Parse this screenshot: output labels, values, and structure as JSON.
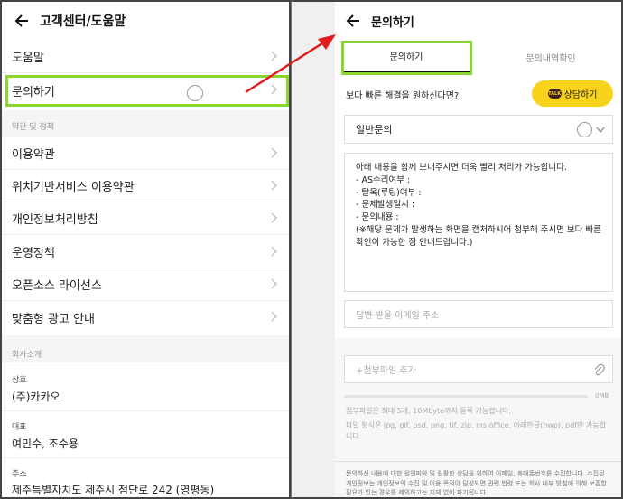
{
  "left": {
    "title": "고객센터/도움말",
    "menu": [
      {
        "label": "도움말"
      },
      {
        "label": "문의하기"
      }
    ],
    "terms_section": "약관 및 정책",
    "terms": [
      {
        "label": "이용약관"
      },
      {
        "label": "위치기반서비스 이용약관"
      },
      {
        "label": "개인정보처리방침"
      },
      {
        "label": "운영정책"
      },
      {
        "label": "오픈소스 라이선스"
      },
      {
        "label": "맞춤형 광고 안내"
      }
    ],
    "company_section": "회사소개",
    "company": [
      {
        "label": "상호",
        "value": "(주)카카오"
      },
      {
        "label": "대표",
        "value": "여민수, 조수용"
      },
      {
        "label": "주소",
        "value": "제주특별자치도 제주시 첨단로 242 (영평동)"
      }
    ]
  },
  "right": {
    "title": "문의하기",
    "tabs": [
      {
        "label": "문의하기"
      },
      {
        "label": "문의내역확인"
      }
    ],
    "quick_question": "보다 빠른 해결을 원하신다면?",
    "chat_button": "상담하기",
    "talk_badge": "TALK",
    "category": "일반문의",
    "message_lines": [
      "아래 내용을 함께 보내주시면 더욱 빨리 처리가 가능합니다.",
      "- AS수리여부 :",
      "- 탈옥(루팅)여부 :",
      "- 문제발생일시 :",
      "- 문의내용 :",
      "(※해당 문제가 발생하는 화면을 캡처하시어 첨부해 주시면 보다 빠른 확인이 가능한 점 안내드립니다.)"
    ],
    "email_placeholder": "답변 받을 이메일 주소",
    "attach_placeholder": "+첨부파일 추가",
    "attach_size": "0MB",
    "attach_progress": 0,
    "attach_note_1": "첨부파일은 최대 5개, 10Mbyte까지 등록 가능합니다.",
    "attach_note_2": "파일 형식은 jpg, gif, psd, png, tif, zip, ms office, 아래한글(hwp), pdf만 가능합니다.",
    "footer_note": "문의하신 내용에 대한 원인파악 및 원활한 상담을 위하여 이메일, 휴대폰번호를 수집합니다. 수집된 개인정보는 개인정보의 수집 및 이용 목적이 달성되면 관련 법령 또는 회사 내부 방침에 의해 보존할 필요가 있는 경우를 제외하고는 지체 없이 파기됩니다."
  },
  "colors": {
    "highlight": "#8cd42f",
    "arrow": "#e01b1b",
    "kakao_yellow": "#f8d31c"
  }
}
